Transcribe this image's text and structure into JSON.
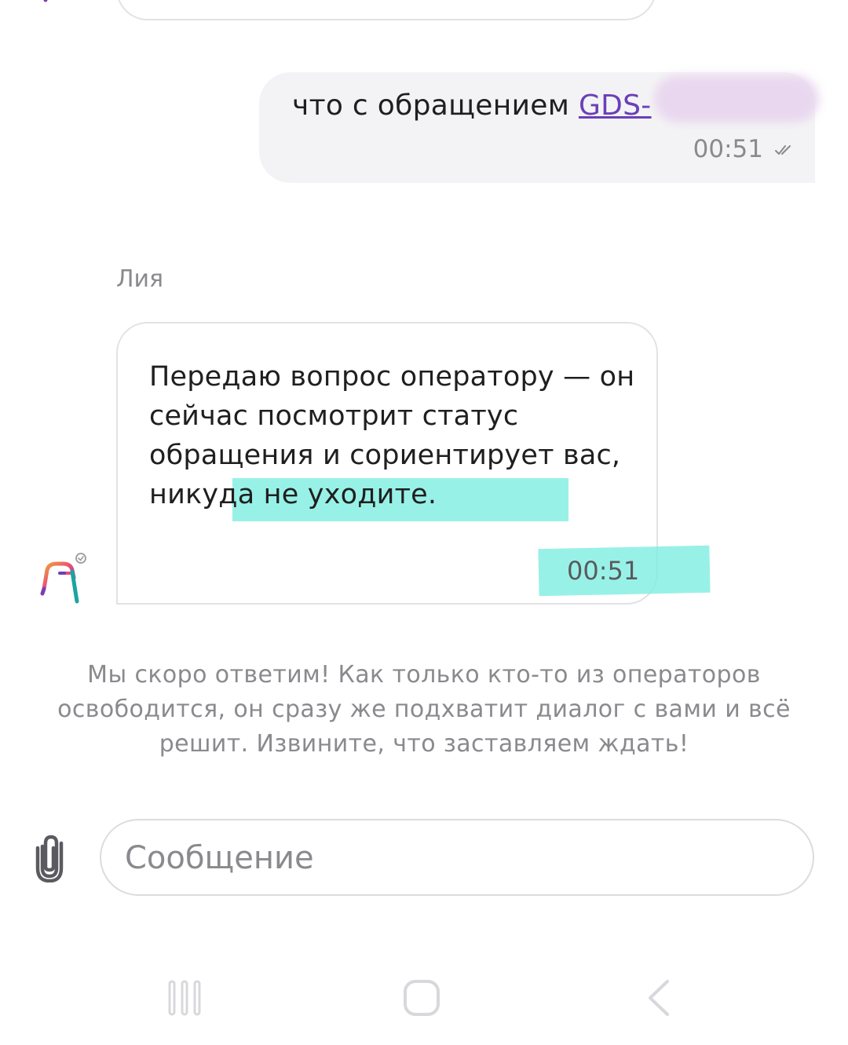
{
  "chat": {
    "user_message": {
      "text": "что с обращением ",
      "ticket_prefix": "GDS-",
      "time": "00:51"
    },
    "bot_sender_name": "Лия",
    "bot_message": {
      "text_part1": "Передаю вопрос оператору — он сейчас посмотрит статус обращения и сориентирует вас, н",
      "text_part2": "икуда не уходите.",
      "time": "00:51"
    },
    "system_notice": "Мы скоро ответим! Как только кто-то из операторов освободится, он сразу же подхватит диалог с вами и всё решит. Извините, что заставляем ждать!"
  },
  "composer": {
    "placeholder": "Сообщение"
  },
  "icons": {
    "attach": "paperclip-icon",
    "read_status": "double-check-icon",
    "avatar": "brand-bag-icon",
    "nav_recents": "recents-icon",
    "nav_home": "home-icon",
    "nav_back": "back-icon"
  },
  "colors": {
    "user_bubble": "#f3f3f5",
    "highlight": "#7eeee0",
    "link": "#6a3fb8",
    "muted_text": "#8a8a8e"
  }
}
